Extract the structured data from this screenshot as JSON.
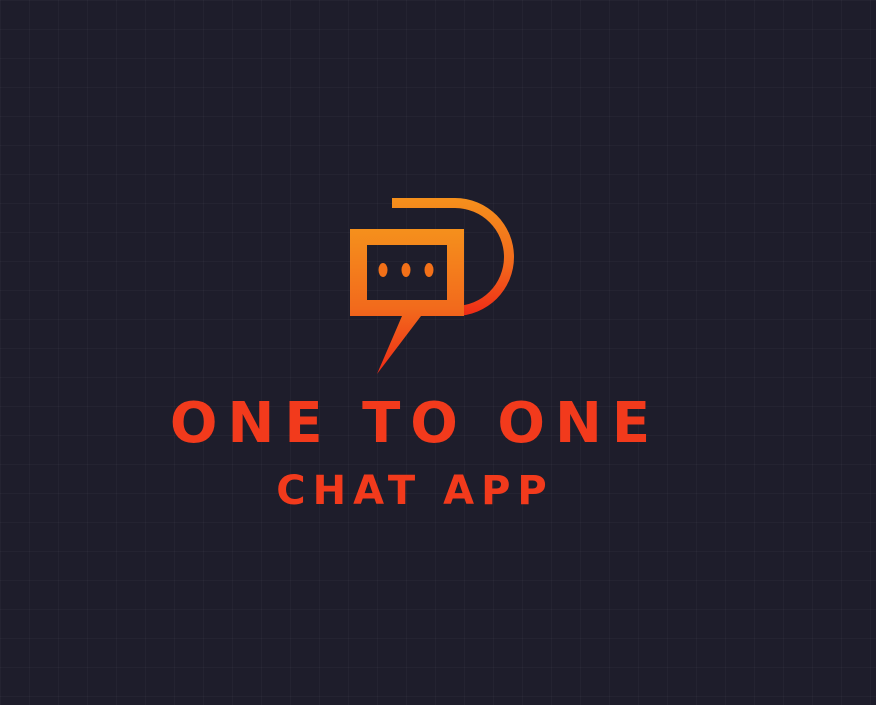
{
  "brand": {
    "title": "ONE TO ONE",
    "subtitle": "CHAT APP",
    "mark_icon": "chat-bubble-d-icon"
  },
  "colors": {
    "background": "#1e1d2b",
    "text": "#f23a1c",
    "gradient_start": "#f5901c",
    "gradient_end": "#ef2a16"
  }
}
